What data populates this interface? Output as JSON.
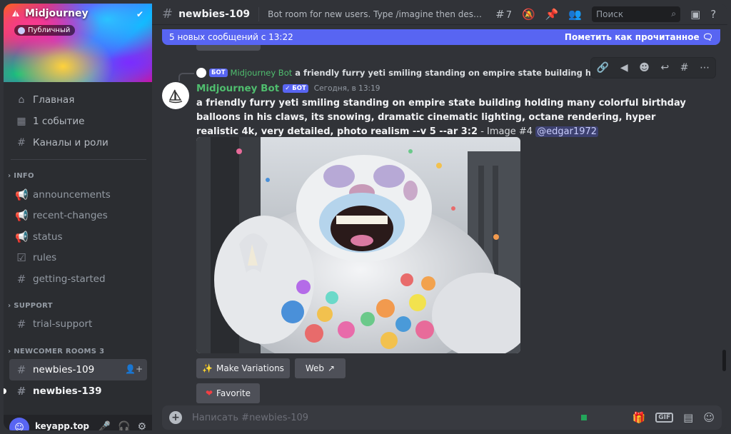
{
  "server": {
    "name": "Midjourney",
    "public_label": "Публичный"
  },
  "nav": [
    {
      "label": "Главная",
      "icon": "home-icon"
    },
    {
      "label": "1 событие",
      "icon": "calendar-icon"
    },
    {
      "label": "Каналы и роли",
      "icon": "channels-icon"
    }
  ],
  "categories": {
    "info": "INFO",
    "support": "SUPPORT",
    "newcomer": "NEWCOMER ROOMS 3"
  },
  "channels": {
    "announcements": "announcements",
    "recent_changes": "recent-changes",
    "status": "status",
    "rules": "rules",
    "getting_started": "getting-started",
    "trial_support": "trial-support",
    "newbies_109": "newbies-109",
    "newbies_139": "newbies-139"
  },
  "user": {
    "name": "keyapp.top"
  },
  "topbar": {
    "title": "newbies-109",
    "topic": "Bot room for new users. Type /imagine then describe wh...",
    "threads_count": "7",
    "search_placeholder": "Поиск"
  },
  "newbar": {
    "text": "5 новых сообщений с 13:22",
    "mark_read": "Пометить как прочитанное"
  },
  "reply": {
    "bot_tag": "БОТ",
    "author": "Midjourney Bot",
    "text": "a friendly furry yeti smiling standing on empire state building holding many colorful birthday balloons"
  },
  "message": {
    "author": "Midjourney Bot",
    "bot_tag": "БОТ",
    "timestamp": "Сегодня, в 13:19",
    "prompt": "a friendly furry yeti smiling standing on empire state building holding many colorful birthday balloons in his claws, its snowing, dramatic cinematic lighting, octane rendering, hyper realistic 4k, very detailed, photo realism --v 5 --ar 3:2",
    "suffix": " - Image #4 ",
    "mention": "@edgar1972"
  },
  "buttons": {
    "variations": "Make Variations",
    "web": "Web",
    "favorite": "Favorite"
  },
  "composer": {
    "placeholder": "Написать #newbies-109",
    "gif": "GIF"
  },
  "colors": {
    "accent": "#5865f2",
    "bot_green": "#4fbd6e",
    "bg": "#313338",
    "sidebar": "#2b2d31"
  }
}
